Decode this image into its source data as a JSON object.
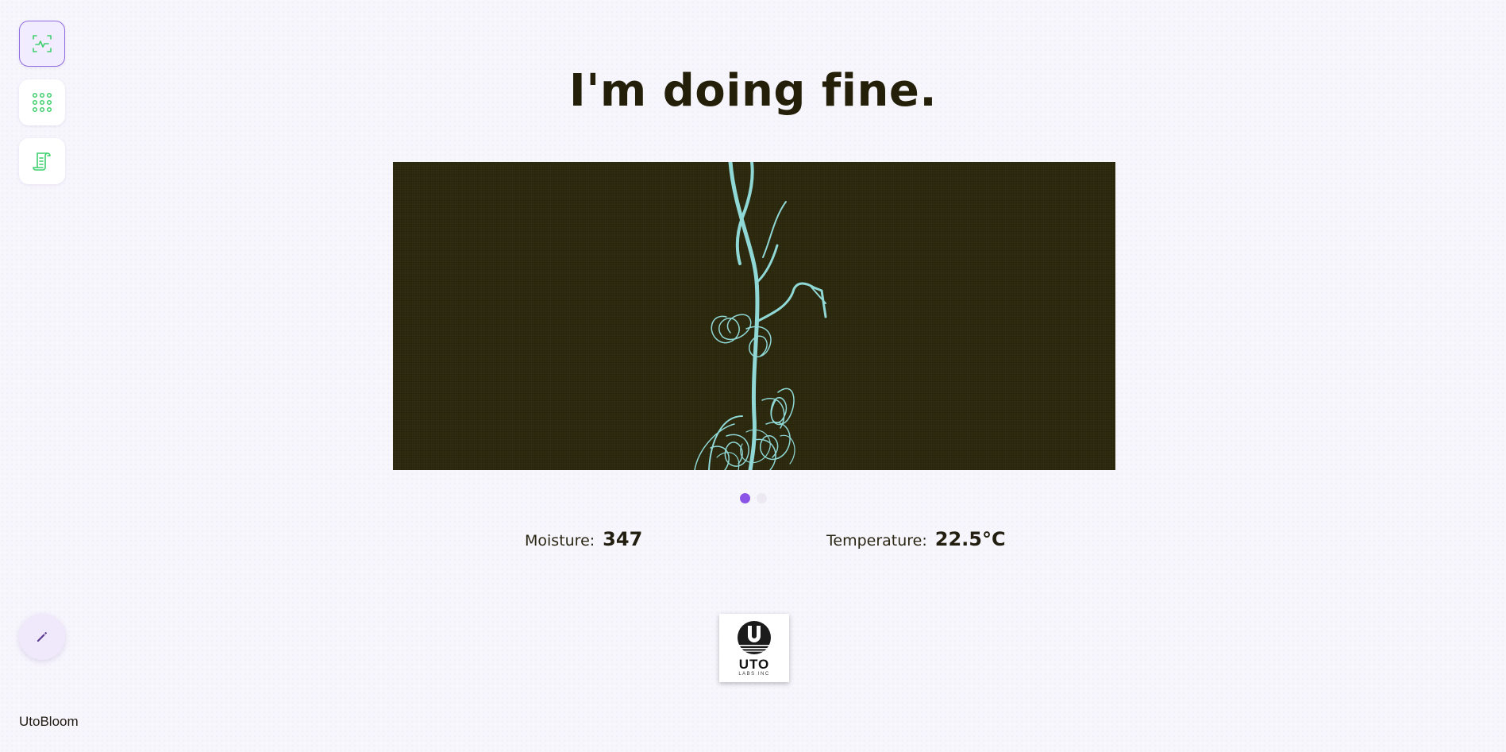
{
  "app": {
    "name": "UtoBloom"
  },
  "nav": {
    "items": [
      {
        "icon": "activity-scan-icon",
        "active": true
      },
      {
        "icon": "grid-dots-icon",
        "active": false
      },
      {
        "icon": "scroll-document-icon",
        "active": false
      }
    ],
    "edit_icon": "pencil-icon"
  },
  "status": {
    "message": "I'm doing fine."
  },
  "carousel": {
    "slide_count": 2,
    "active_index": 0
  },
  "readings": {
    "moisture_label": "Moisture:",
    "moisture_value": "347",
    "temperature_label": "Temperature:",
    "temperature_value": "22.5°C"
  },
  "logo": {
    "text": "UTO",
    "subtext": "LABS INC"
  },
  "colors": {
    "accent": "#8a55e6",
    "icon_green": "#3fcf6e",
    "plant_bg": "#2c290f",
    "plant_stroke": "#8fd8d6"
  }
}
